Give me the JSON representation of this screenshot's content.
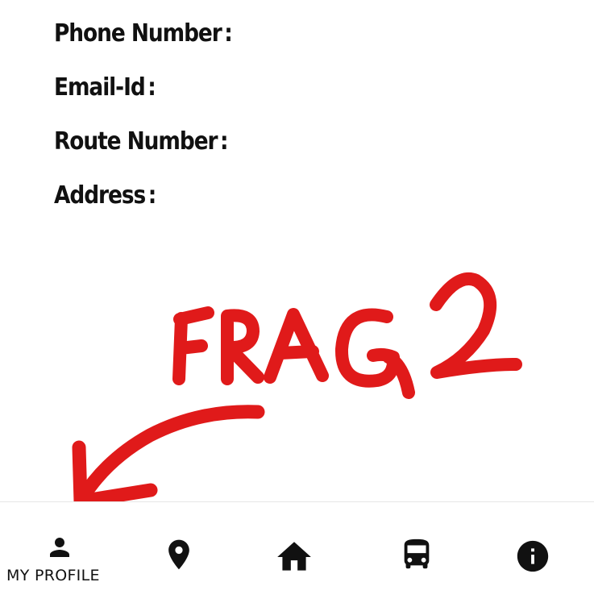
{
  "profile": {
    "fields": [
      {
        "label": "Phone Number",
        "colon": ":"
      },
      {
        "label": "Email-Id",
        "colon": ":"
      },
      {
        "label": "Route Number",
        "colon": ":"
      },
      {
        "label": "Address",
        "colon": ":"
      }
    ]
  },
  "annotation": {
    "text": "FRAG2",
    "color": "#e01a1a"
  },
  "bottom_nav": {
    "items": [
      {
        "icon": "person-icon",
        "label": "MY PROFILE",
        "active": true
      },
      {
        "icon": "location-pin-icon",
        "label": ""
      },
      {
        "icon": "home-icon",
        "label": ""
      },
      {
        "icon": "bus-icon",
        "label": ""
      },
      {
        "icon": "info-icon",
        "label": ""
      }
    ]
  }
}
